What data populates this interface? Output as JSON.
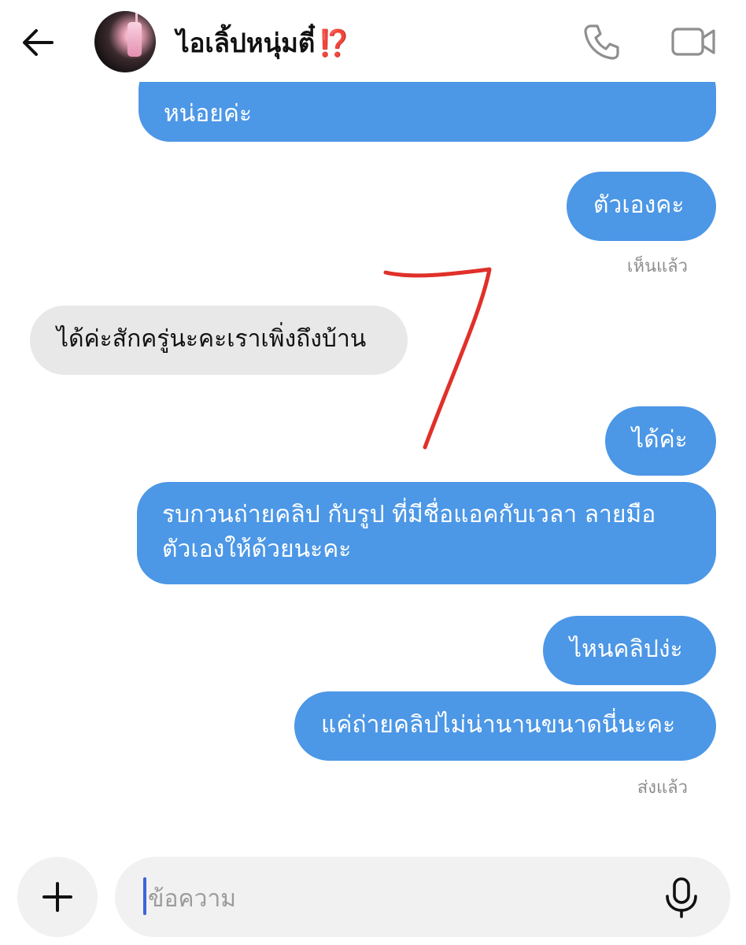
{
  "header": {
    "contact_name": "ไอเลิ้ปหนุ่มตี๋",
    "name_emoji": "⁉️"
  },
  "messages": [
    {
      "direction": "outgoing",
      "text": "หน่อยค่ะ"
    },
    {
      "direction": "outgoing",
      "text": "ตัวเองคะ"
    },
    {
      "direction": "incoming",
      "text": "ได้ค่ะสักครู่นะคะเราเพิ่งถึงบ้าน"
    },
    {
      "direction": "outgoing",
      "text": "ได้ค่ะ"
    },
    {
      "direction": "outgoing",
      "lines": [
        "รบกวนถ่ายคลิป กับรูป ที่มีชื่อแอคกับเวลา ลายมือ",
        "ตัวเองให้ด้วยนะคะ"
      ]
    },
    {
      "direction": "outgoing",
      "text": "ไหนคลิปง่ะ"
    },
    {
      "direction": "outgoing",
      "text": "แค่ถ่ายคลิปไม่น่านานขนาดนี่นะคะ"
    }
  ],
  "status": {
    "seen": "เห็นแล้ว",
    "sent": "ส่งแล้ว"
  },
  "composer": {
    "placeholder": "ข้อความ"
  },
  "colors": {
    "outgoing_bubble": "#4c97e6",
    "incoming_bubble": "#e8e8e8",
    "annotation": "#e0302a"
  }
}
